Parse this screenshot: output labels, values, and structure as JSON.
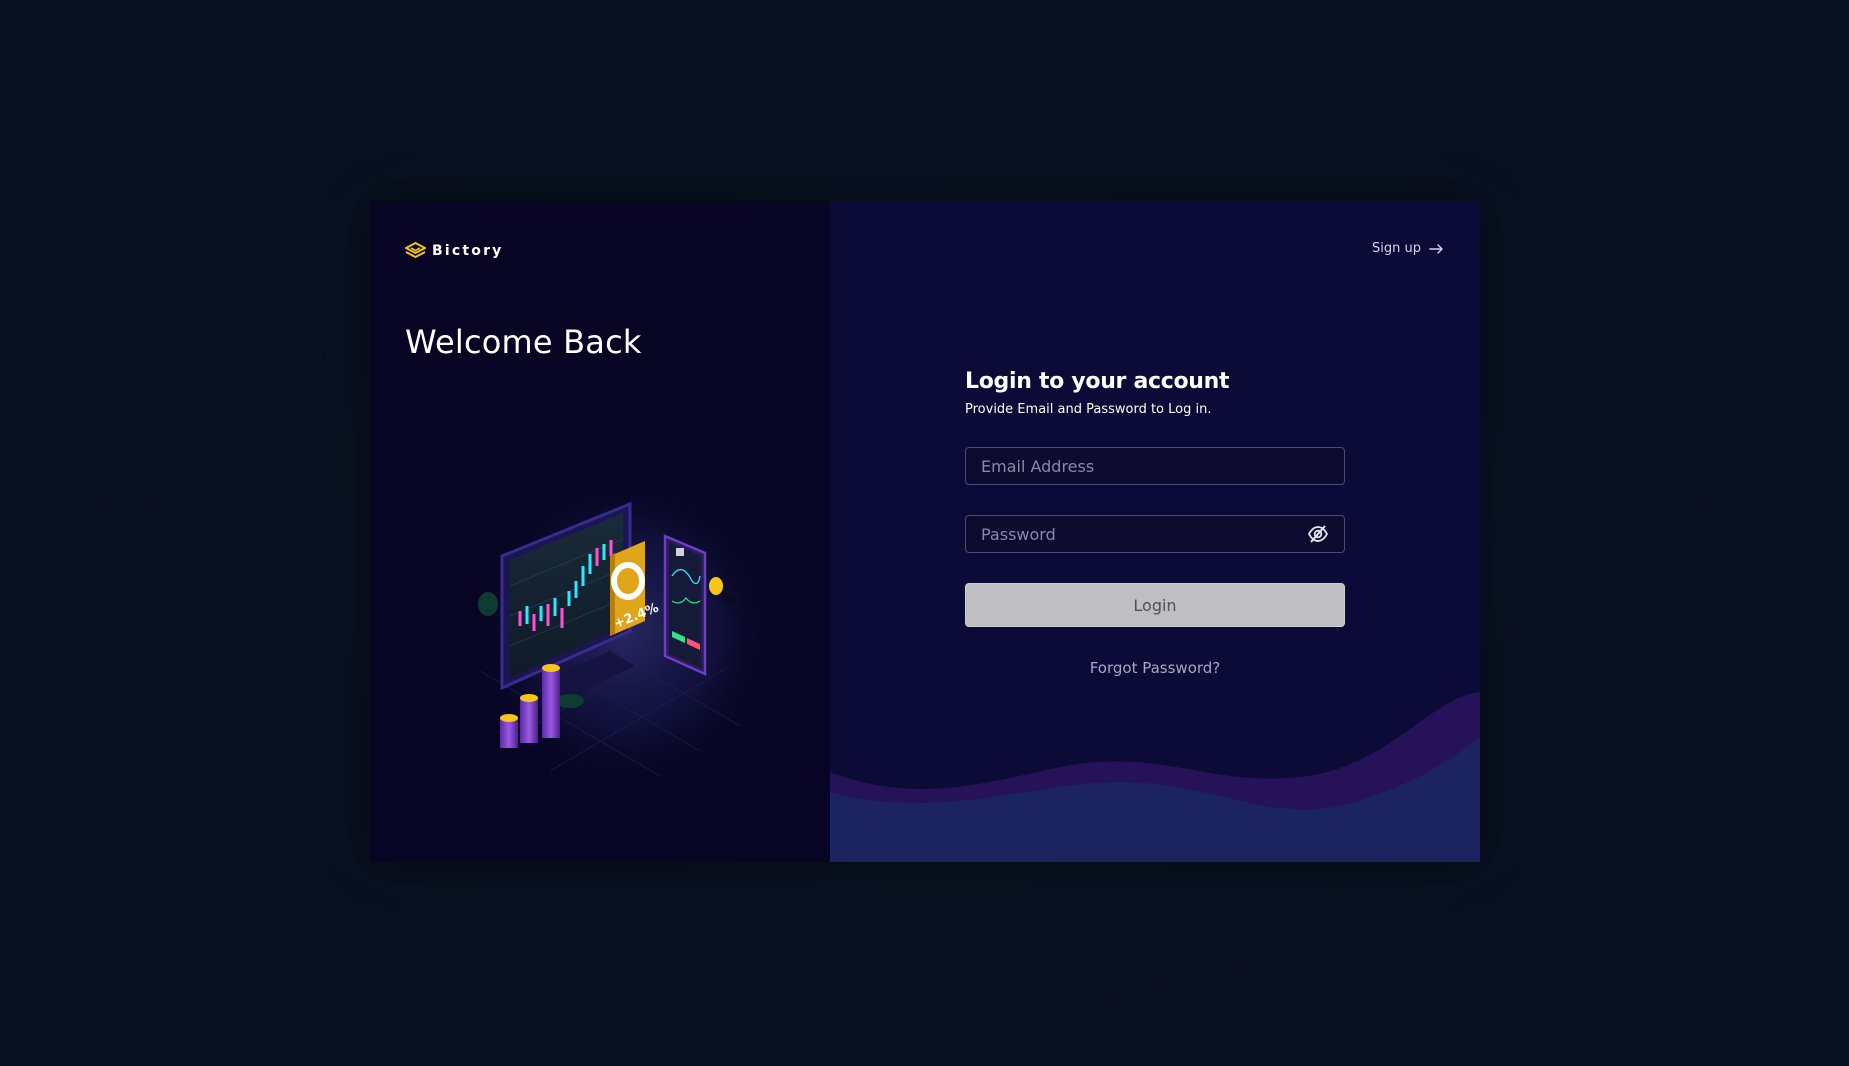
{
  "brand": {
    "name": "Bictory",
    "accent_color": "#f5c518"
  },
  "left_panel": {
    "heading": "Welcome Back",
    "illustration_label": "+2.4%"
  },
  "header": {
    "signup_label": "Sign up",
    "signup_icon": "arrow-right-icon"
  },
  "login_form": {
    "title": "Login to your account",
    "subtitle": "Provide Email and Password to Log in.",
    "email": {
      "placeholder": "Email Address",
      "value": ""
    },
    "password": {
      "placeholder": "Password",
      "value": "",
      "toggle_icon": "eye-off-icon"
    },
    "login_label": "Login",
    "forgot_label": "Forgot Password?"
  },
  "colors": {
    "page_background": "#07101f",
    "left_panel": "#070523",
    "right_panel": "#0c0a36",
    "button_disabled": "#bfbfc1"
  }
}
